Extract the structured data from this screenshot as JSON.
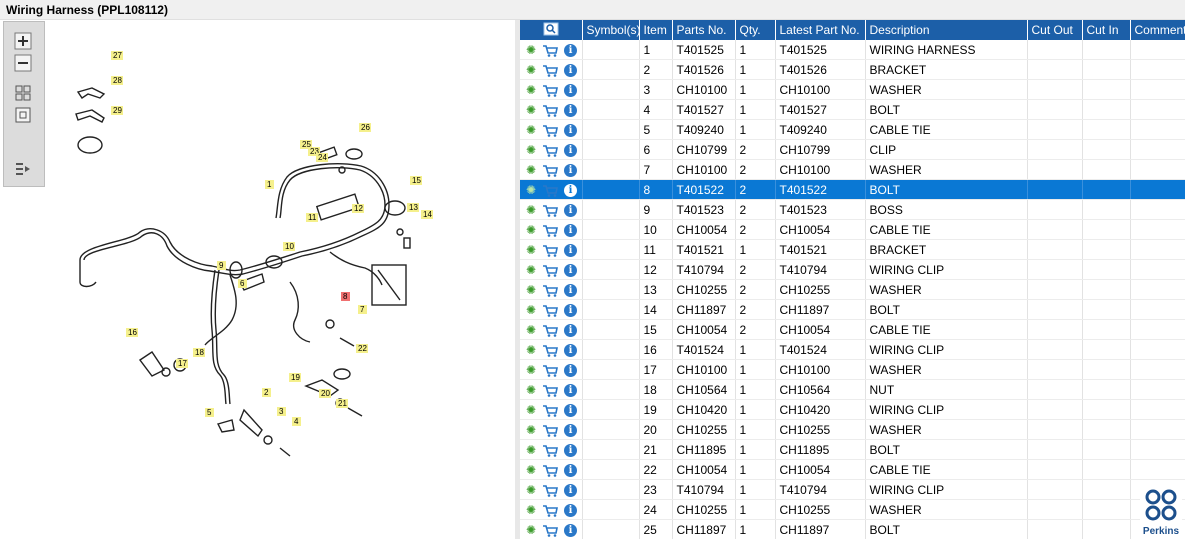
{
  "window": {
    "title": "Wiring Harness (PPL108112)"
  },
  "toolbar": {
    "zoom_in": "zoom-in",
    "zoom_out": "zoom-out",
    "fit_all": "fit-all",
    "fit_window": "fit-window",
    "export": "export"
  },
  "diagram": {
    "callouts": [
      "1",
      "2",
      "3",
      "4",
      "5",
      "6",
      "7",
      "8",
      "9",
      "10",
      "11",
      "12",
      "13",
      "14",
      "15",
      "16",
      "17",
      "18",
      "19",
      "20",
      "21",
      "22",
      "23",
      "24",
      "25",
      "26",
      "27",
      "28",
      "29"
    ],
    "highlighted": "8"
  },
  "grid": {
    "columns": [
      "",
      "Symbol(s)",
      "Item",
      "Parts No.",
      "Qty.",
      "Latest Part No.",
      "Description",
      "Cut Out",
      "Cut In",
      "Comment"
    ],
    "selected_item": "8",
    "rows": [
      [
        "",
        "1",
        "T401525",
        "1",
        "T401525",
        "WIRING HARNESS",
        "",
        "",
        ""
      ],
      [
        "",
        "2",
        "T401526",
        "1",
        "T401526",
        "BRACKET",
        "",
        "",
        ""
      ],
      [
        "",
        "3",
        "CH10100",
        "1",
        "CH10100",
        "WASHER",
        "",
        "",
        ""
      ],
      [
        "",
        "4",
        "T401527",
        "1",
        "T401527",
        "BOLT",
        "",
        "",
        ""
      ],
      [
        "",
        "5",
        "T409240",
        "1",
        "T409240",
        "CABLE TIE",
        "",
        "",
        ""
      ],
      [
        "",
        "6",
        "CH10799",
        "2",
        "CH10799",
        "CLIP",
        "",
        "",
        ""
      ],
      [
        "",
        "7",
        "CH10100",
        "2",
        "CH10100",
        "WASHER",
        "",
        "",
        ""
      ],
      [
        "",
        "8",
        "T401522",
        "2",
        "T401522",
        "BOLT",
        "",
        "",
        ""
      ],
      [
        "",
        "9",
        "T401523",
        "2",
        "T401523",
        "BOSS",
        "",
        "",
        ""
      ],
      [
        "",
        "10",
        "CH10054",
        "2",
        "CH10054",
        "CABLE TIE",
        "",
        "",
        ""
      ],
      [
        "",
        "11",
        "T401521",
        "1",
        "T401521",
        "BRACKET",
        "",
        "",
        ""
      ],
      [
        "",
        "12",
        "T410794",
        "2",
        "T410794",
        "WIRING CLIP",
        "",
        "",
        ""
      ],
      [
        "",
        "13",
        "CH10255",
        "2",
        "CH10255",
        "WASHER",
        "",
        "",
        ""
      ],
      [
        "",
        "14",
        "CH11897",
        "2",
        "CH11897",
        "BOLT",
        "",
        "",
        ""
      ],
      [
        "",
        "15",
        "CH10054",
        "2",
        "CH10054",
        "CABLE TIE",
        "",
        "",
        ""
      ],
      [
        "",
        "16",
        "T401524",
        "1",
        "T401524",
        "WIRING CLIP",
        "",
        "",
        ""
      ],
      [
        "",
        "17",
        "CH10100",
        "1",
        "CH10100",
        "WASHER",
        "",
        "",
        ""
      ],
      [
        "",
        "18",
        "CH10564",
        "1",
        "CH10564",
        "NUT",
        "",
        "",
        ""
      ],
      [
        "",
        "19",
        "CH10420",
        "1",
        "CH10420",
        "WIRING CLIP",
        "",
        "",
        ""
      ],
      [
        "",
        "20",
        "CH10255",
        "1",
        "CH10255",
        "WASHER",
        "",
        "",
        ""
      ],
      [
        "",
        "21",
        "CH11895",
        "1",
        "CH11895",
        "BOLT",
        "",
        "",
        ""
      ],
      [
        "",
        "22",
        "CH10054",
        "1",
        "CH10054",
        "CABLE TIE",
        "",
        "",
        ""
      ],
      [
        "",
        "23",
        "T410794",
        "1",
        "T410794",
        "WIRING CLIP",
        "",
        "",
        ""
      ],
      [
        "",
        "24",
        "CH10255",
        "1",
        "CH10255",
        "WASHER",
        "",
        "",
        ""
      ],
      [
        "",
        "25",
        "CH11897",
        "1",
        "CH11897",
        "BOLT",
        "",
        "",
        ""
      ]
    ]
  },
  "brand": {
    "name": "Perkins",
    "color": "#1c4f8c"
  },
  "colors": {
    "header": "#1c5fa8",
    "selected": "#0a78d4",
    "callout": "#f5f08c",
    "callout_highlight": "#f07070"
  }
}
